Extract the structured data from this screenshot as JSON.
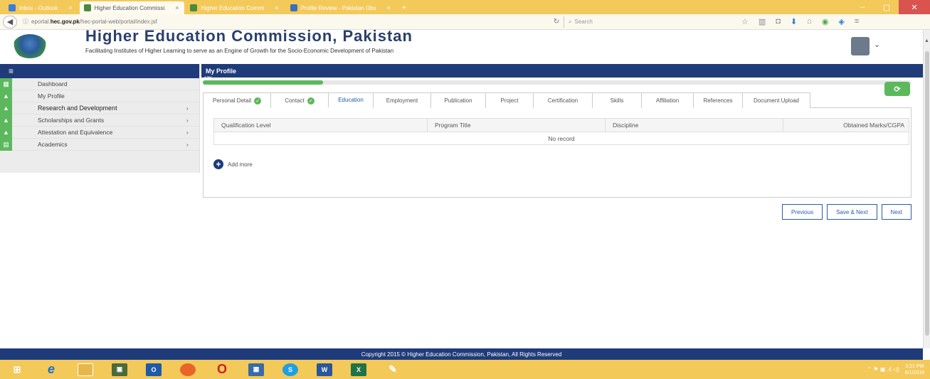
{
  "browser": {
    "tabs": [
      {
        "label": "Inbox - Outlook",
        "fav_color": "#3b7dd8",
        "active": false
      },
      {
        "label": "Higher Education Commissi",
        "fav_color": "#4a8a3a",
        "active": true
      },
      {
        "label": "Higher Education Commi",
        "fav_color": "#4a8a3a",
        "active": false
      },
      {
        "label": "Profile Review - Pakistan Obs",
        "fav_color": "#3b6fb8",
        "active": false
      }
    ],
    "new_tab": "+",
    "url_prefix": "eportal.",
    "url_domain": "hec.gov.pk",
    "url_rest": "/hec-portal-web/portal/index.jsf",
    "search_placeholder": "Search",
    "window_controls": {
      "minimize": "–",
      "maximize": "▢",
      "close": "✕"
    }
  },
  "header": {
    "title": "Higher Education Commission, Pakistan",
    "subtitle": "Facilitating Institutes of Higher Learning to serve as an Engine of Growth for the Socio-Economic Development of Pakistan"
  },
  "sidebar": {
    "toggle": "≡",
    "items": [
      {
        "label": "Dashboard",
        "icon": "dashboard-icon",
        "glyph": "▦",
        "bold": false,
        "chevron": ""
      },
      {
        "label": "My Profile",
        "icon": "user-icon",
        "glyph": "▲",
        "bold": false,
        "chevron": ""
      },
      {
        "label": "Research and Development",
        "icon": "research-icon",
        "glyph": "▲",
        "bold": true,
        "chevron": "›"
      },
      {
        "label": "Scholarships and Grants",
        "icon": "scholarship-icon",
        "glyph": "▲",
        "bold": false,
        "chevron": "›"
      },
      {
        "label": "Attestation and Equivalence",
        "icon": "attestation-icon",
        "glyph": "▲",
        "bold": false,
        "chevron": "›"
      },
      {
        "label": "Academics",
        "icon": "academics-icon",
        "glyph": "▤",
        "bold": false,
        "chevron": "›"
      }
    ]
  },
  "main": {
    "title": "My Profile",
    "progress": {
      "percent": 17,
      "label": "17%"
    },
    "tabs": [
      {
        "label": "Personal Detail",
        "done": true,
        "active": false,
        "width": 96
      },
      {
        "label": "Contact",
        "done": true,
        "active": false,
        "width": 82
      },
      {
        "label": "Education",
        "done": false,
        "active": true,
        "width": 64
      },
      {
        "label": "Employment",
        "done": false,
        "active": false,
        "width": 82
      },
      {
        "label": "Publication",
        "done": false,
        "active": false,
        "width": 78
      },
      {
        "label": "Project",
        "done": false,
        "active": false,
        "width": 68
      },
      {
        "label": "Certification",
        "done": false,
        "active": false,
        "width": 84
      },
      {
        "label": "Skills",
        "done": false,
        "active": false,
        "width": 70
      },
      {
        "label": "Affiliation",
        "done": false,
        "active": false,
        "width": 74
      },
      {
        "label": "References",
        "done": false,
        "active": false,
        "width": 70
      },
      {
        "label": "Document Upload",
        "done": false,
        "active": false,
        "width": 96
      }
    ],
    "table": {
      "columns": [
        "Qualification Level",
        "Program Title",
        "Discipline",
        "Obtained Marks/CGPA"
      ],
      "empty_message": "No record"
    },
    "add_label": "Add more",
    "actions": {
      "previous": "Previous",
      "save_next": "Save & Next",
      "next": "Next"
    }
  },
  "footer": {
    "text": "Copyright 2015 © Higher Education Commission, Pakistan, All Rights Reserved"
  },
  "taskbar": {
    "clock_time": "3:21 PM",
    "clock_date": "6/1/2016",
    "tray": "⌃  ⚑  ▣  .ıl  ◁)"
  },
  "colors": {
    "navy": "#1f3b7a",
    "green": "#5cb85c",
    "taskbar": "#f3c95a"
  }
}
